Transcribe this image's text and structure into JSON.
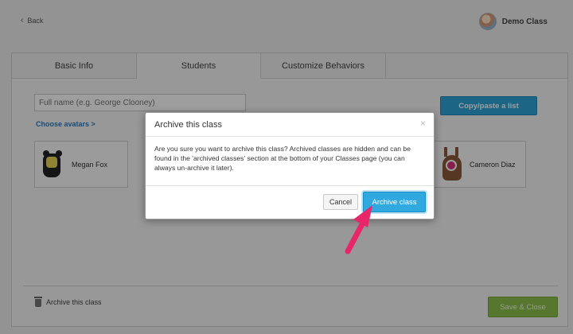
{
  "header": {
    "back_label": "Back",
    "class_name": "Demo Class"
  },
  "tabs": [
    {
      "label": "Basic Info",
      "active": false
    },
    {
      "label": "Students",
      "active": true
    },
    {
      "label": "Customize Behaviors",
      "active": false
    }
  ],
  "add_student": {
    "name_placeholder": "Full name (e.g. George Clooney)",
    "choose_avatars_label": "Choose avatars >",
    "paste_list_label": "Copy/paste a list"
  },
  "students": [
    {
      "name": "Megan Fox",
      "avatar": "yellow-black-monster-icon"
    },
    {
      "name": "Cameron Diaz",
      "avatar": "brown-one-eyed-monster-icon"
    }
  ],
  "footer": {
    "archive_label": "Archive this class",
    "save_label": "Save & Close"
  },
  "dialog": {
    "title": "Archive this class",
    "close_glyph": "×",
    "body": "Are you sure you want to archive this class? Archived classes are hidden and can be found in the 'archived classes' section at the bottom of your Classes page (you can always un-archive it later).",
    "cancel_label": "Cancel",
    "confirm_label": "Archive class"
  },
  "colors": {
    "primary_button": "#2fa9e0",
    "save_button": "#8cc04a",
    "annotation_arrow": "#e8266a",
    "link": "#2a7bbf"
  }
}
